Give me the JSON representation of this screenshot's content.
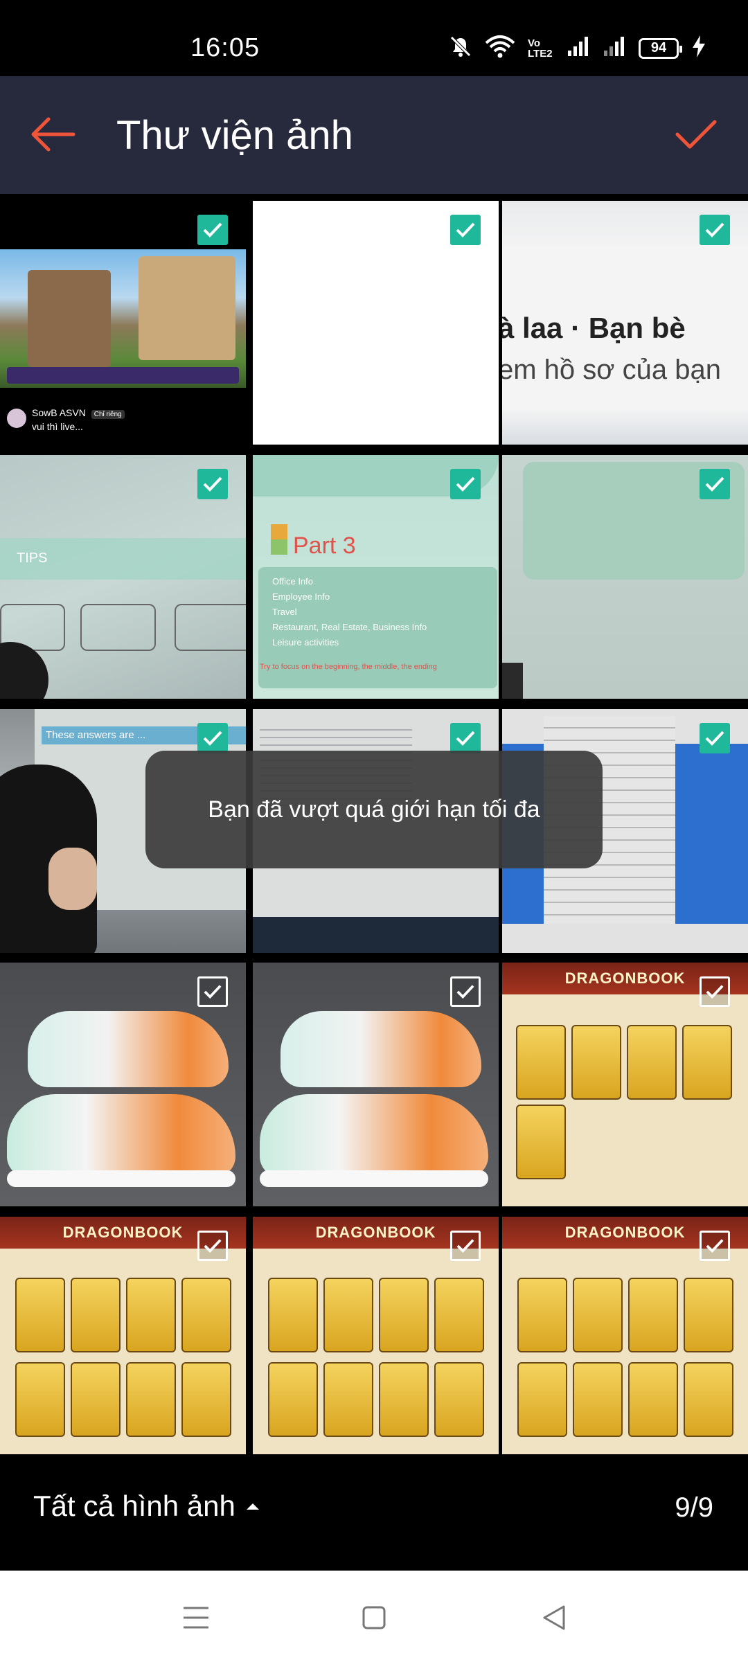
{
  "status_bar": {
    "time": "16:05",
    "battery": "94",
    "network_label": "Vo LTE2",
    "icons": [
      "mute-icon",
      "wifi-icon",
      "volte-icon",
      "signal-icon",
      "signal-icon",
      "battery-icon",
      "charging-icon"
    ]
  },
  "toolbar": {
    "title": "Thư viện ảnh",
    "back_icon": "arrow-left-icon",
    "confirm_icon": "checkmark-icon",
    "accent_color": "#f0553a",
    "background": "#272a3d"
  },
  "grid": {
    "tiles": [
      {
        "kind": "game-screenshot",
        "checked": true,
        "caption_name": "SowB ASVN",
        "caption_tag": "Chỉ riêng",
        "caption_text": "vui thì live..."
      },
      {
        "kind": "blank",
        "checked": true
      },
      {
        "kind": "profile-text",
        "checked": true,
        "line1": "à laa · Bạn bè",
        "line2": "em hồ sơ của bạn"
      },
      {
        "kind": "projector-tips",
        "checked": true,
        "label": "TIPS"
      },
      {
        "kind": "slide-part3",
        "checked": true,
        "heading": "Part 3",
        "bullets": [
          "Office Info",
          "Employee Info",
          "Travel",
          "Restaurant, Real Estate, Business Info",
          "Leisure activities"
        ],
        "footer": "Try to focus on the beginning, the middle, the ending"
      },
      {
        "kind": "projector-blank",
        "checked": true
      },
      {
        "kind": "classroom",
        "checked": true,
        "label": "These answers are ..."
      },
      {
        "kind": "code-screen",
        "checked": true
      },
      {
        "kind": "menu-screen",
        "checked": true
      },
      {
        "kind": "sneakers",
        "checked": false
      },
      {
        "kind": "sneakers",
        "checked": false
      },
      {
        "kind": "dragonbook",
        "checked": false,
        "title": "DRAGONBOOK"
      },
      {
        "kind": "dragonbook",
        "checked": false,
        "title": "DRAGONBOOK"
      },
      {
        "kind": "dragonbook",
        "checked": false,
        "title": "DRAGONBOOK"
      },
      {
        "kind": "dragonbook",
        "checked": false,
        "title": "DRAGONBOOK"
      }
    ],
    "check_color": "#1fb89a"
  },
  "toast": {
    "message": "Bạn đã vượt quá giới hạn tối đa"
  },
  "bottom_bar": {
    "album_label": "Tất cả hình ảnh",
    "album_icon": "caret-up-icon",
    "count": "9/9"
  },
  "nav_bar": {
    "icons": [
      "menu-icon",
      "home-icon",
      "back-icon"
    ]
  }
}
